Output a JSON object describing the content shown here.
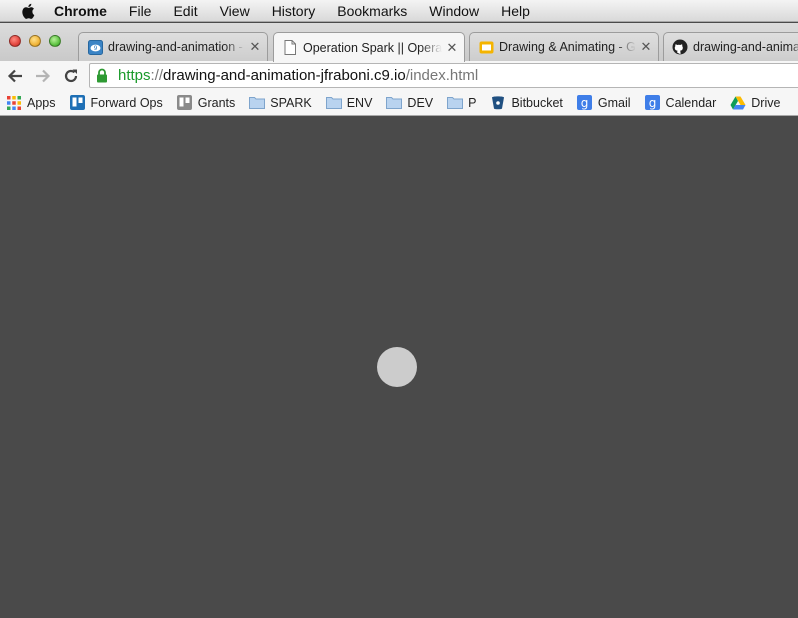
{
  "menubar": {
    "app_name": "Chrome",
    "items": [
      "File",
      "Edit",
      "View",
      "History",
      "Bookmarks",
      "Window",
      "Help"
    ]
  },
  "tabs": [
    {
      "title": "drawing-and-animation - ",
      "favicon": "cloud9-icon",
      "active": false
    },
    {
      "title": "Operation Spark || Operati",
      "favicon": "page-icon",
      "active": true
    },
    {
      "title": "Drawing & Animating - Go",
      "favicon": "google-slides-icon",
      "active": false
    },
    {
      "title": "drawing-and-animat",
      "favicon": "github-icon",
      "active": false
    }
  ],
  "omnibox": {
    "scheme": "https",
    "separator": "://",
    "host": "drawing-and-animation-jfraboni.c9.io",
    "path": "/index.html"
  },
  "bookmarks": [
    {
      "label": "Apps",
      "icon": "apps-grid-icon"
    },
    {
      "label": "Forward Ops",
      "icon": "trello-icon"
    },
    {
      "label": "Grants",
      "icon": "trello-gray-icon"
    },
    {
      "label": "SPARK",
      "icon": "folder-icon"
    },
    {
      "label": "ENV",
      "icon": "folder-icon"
    },
    {
      "label": "DEV",
      "icon": "folder-icon"
    },
    {
      "label": "P",
      "icon": "folder-icon"
    },
    {
      "label": "Bitbucket",
      "icon": "bitbucket-icon"
    },
    {
      "label": "Gmail",
      "icon": "google-icon"
    },
    {
      "label": "Calendar",
      "icon": "google-icon"
    },
    {
      "label": "Drive",
      "icon": "drive-icon"
    }
  ],
  "colors": {
    "canvas_background": "#4a4a4a",
    "ball": "#cccccc",
    "secure_scheme": "#1a9a2a"
  }
}
